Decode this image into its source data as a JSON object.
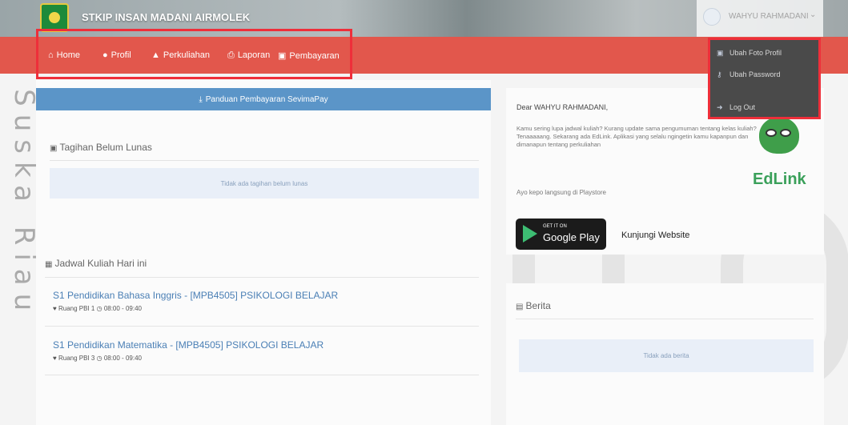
{
  "header": {
    "app_title": "STKIP INSAN MADANI AIRMOLEK",
    "user_name": "WAHYU RAHMADANI",
    "user_caret": "⌄"
  },
  "watermark": {
    "text": "UIN Suska Riau"
  },
  "nav": {
    "items": [
      {
        "icon": "⌂",
        "label": "Home"
      },
      {
        "icon": "●",
        "label": "Profil"
      },
      {
        "icon": "▲",
        "label": "Perkuliahan"
      },
      {
        "icon": "⎙",
        "label": "Laporan"
      },
      {
        "icon": "▣",
        "label": "Pembayaran"
      }
    ]
  },
  "user_menu": {
    "items": [
      {
        "icon": "▣",
        "label": "Ubah Foto Profil"
      },
      {
        "icon": "⚷",
        "label": "Ubah Password"
      },
      {
        "icon": "➜",
        "label": "Log Out"
      }
    ]
  },
  "payment_guide": {
    "label": "Panduan Pembayaran SevimaPay",
    "icon": "⤓"
  },
  "bills": {
    "title": "Tagihan Belum Lunas",
    "icon": "▣",
    "empty": "Tidak ada tagihan belum lunas"
  },
  "schedule": {
    "title": "Jadwal Kuliah Hari ini",
    "icon": "▦",
    "courses": [
      {
        "name": "S1 Pendidikan Bahasa Inggris - [MPB4505] PSIKOLOGI BELAJAR",
        "room": "Ruang PBI 1",
        "time": "08:00 - 09:40"
      },
      {
        "name": "S1 Pendidikan Matematika - [MPB4505] PSIKOLOGI BELAJAR",
        "room": "Ruang PBI 3",
        "time": "08:00 - 09:40"
      }
    ]
  },
  "promo": {
    "greeting": "Dear WAHYU RAHMADANI,",
    "line1": "Kamu sering lupa jadwal kuliah? Kurang update sama pengumuman tentang kelas kuliah?",
    "line2": "Tenaaaaang. Sekarang ada EdLink. Aplikasi yang selalu ngingetin kamu kapanpun dan dimanapun tentang perkuliahan",
    "playstore_text": "Ayo kepo langsung di Playstore",
    "gplay_small": "GET IT ON",
    "gplay_big": "Google Play",
    "visit_label": "Kunjungi Website",
    "brand": "EdLink"
  },
  "news": {
    "title": "Berita",
    "icon": "▤",
    "empty": "Tidak ada berita"
  },
  "colors": {
    "nav_bg": "#e2574c",
    "highlight": "#ee2f3a",
    "button_blue": "#5b95c8",
    "link_blue": "#4a7fb5",
    "edlink_green": "#3aa05a"
  }
}
